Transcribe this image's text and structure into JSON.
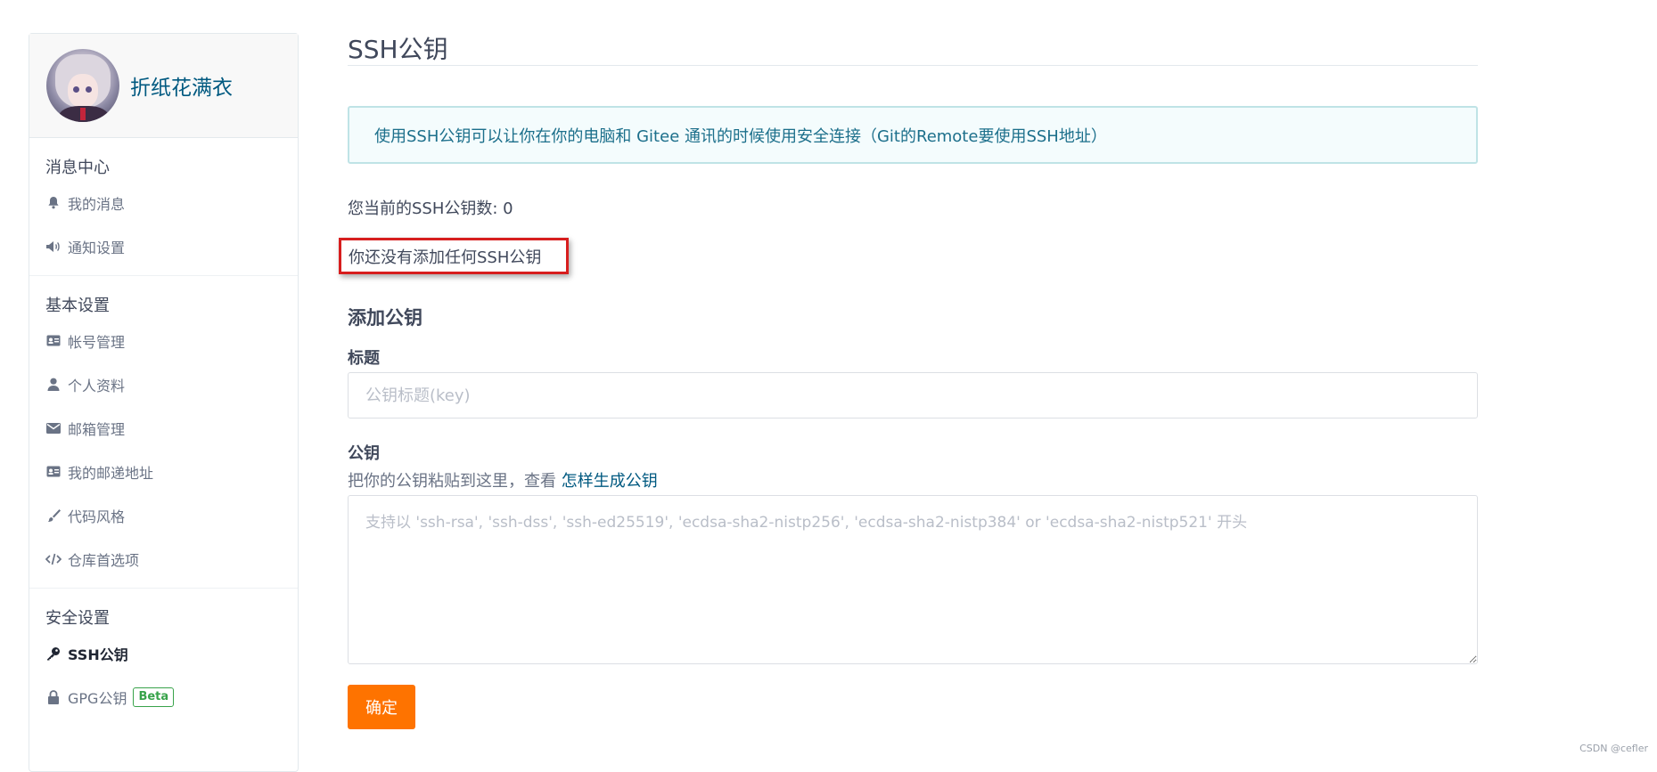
{
  "profile": {
    "name": "折纸花满衣"
  },
  "sidebar": {
    "sections": [
      {
        "title": "消息中心",
        "items": [
          {
            "label": "我的消息",
            "icon": "bell-icon"
          },
          {
            "label": "通知设置",
            "icon": "megaphone-icon"
          }
        ]
      },
      {
        "title": "基本设置",
        "items": [
          {
            "label": "帐号管理",
            "icon": "id-card-icon"
          },
          {
            "label": "个人资料",
            "icon": "user-icon"
          },
          {
            "label": "邮箱管理",
            "icon": "envelope-icon"
          },
          {
            "label": "我的邮递地址",
            "icon": "address-card-icon"
          },
          {
            "label": "代码风格",
            "icon": "paintbrush-icon"
          },
          {
            "label": "仓库首选项",
            "icon": "code-icon"
          }
        ]
      },
      {
        "title": "安全设置",
        "items": [
          {
            "label": "SSH公钥",
            "icon": "key-icon",
            "active": true
          },
          {
            "label": "GPG公钥",
            "icon": "lock-icon",
            "badge": "Beta"
          }
        ]
      }
    ]
  },
  "main": {
    "title": "SSH公钥",
    "info": "使用SSH公钥可以让你在你的电脑和 Gitee 通讯的时候使用安全连接（Git的Remote要使用SSH地址）",
    "key_count": "您当前的SSH公钥数: 0",
    "no_key_message": "你还没有添加任何SSH公钥",
    "add_heading": "添加公钥",
    "title_label": "标题",
    "title_placeholder": "公钥标题(key)",
    "key_label": "公钥",
    "key_hint": "把你的公钥粘贴到这里，查看",
    "key_hint_link": "怎样生成公钥",
    "key_placeholder": "支持以 'ssh-rsa', 'ssh-dss', 'ssh-ed25519', 'ecdsa-sha2-nistp256', 'ecdsa-sha2-nistp384' or 'ecdsa-sha2-nistp521' 开头",
    "submit_label": "确定"
  },
  "watermark": "CSDN @cefler",
  "colors": {
    "accent": "#fe7300",
    "link": "#005980",
    "highlight_border": "#d71e1e",
    "beta": "#38a34a"
  }
}
